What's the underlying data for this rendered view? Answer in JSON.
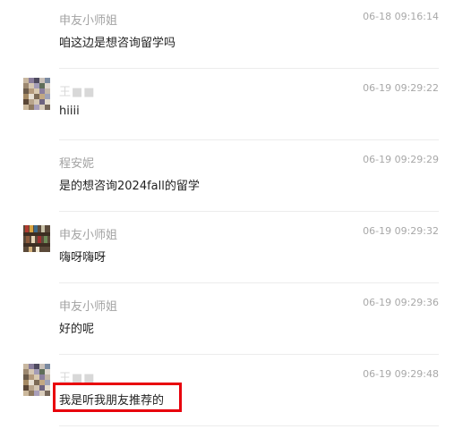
{
  "messages": [
    {
      "sender": "申友小师姐",
      "time": "06-18 09:16:14",
      "text": "咱这边是想咨询留学吗"
    },
    {
      "sender": "王■■",
      "time": "06-19 09:29:22",
      "text": "hiiii"
    },
    {
      "sender": "程安妮",
      "time": "06-19 09:29:29",
      "text": "是的想咨询2024fall的留学"
    },
    {
      "sender": "申友小师姐",
      "time": "06-19 09:29:32",
      "text": "嗨呀嗨呀"
    },
    {
      "sender": "申友小师姐",
      "time": "06-19 09:29:36",
      "text": "好的呢"
    },
    {
      "sender": "王■■",
      "time": "06-19 09:29:48",
      "text": "我是听我朋友推荐的"
    }
  ],
  "colors": {
    "highlight_border": "#e8000c",
    "sender_text": "#a3a3a3",
    "message_text": "#222222",
    "separator": "#ececec"
  }
}
